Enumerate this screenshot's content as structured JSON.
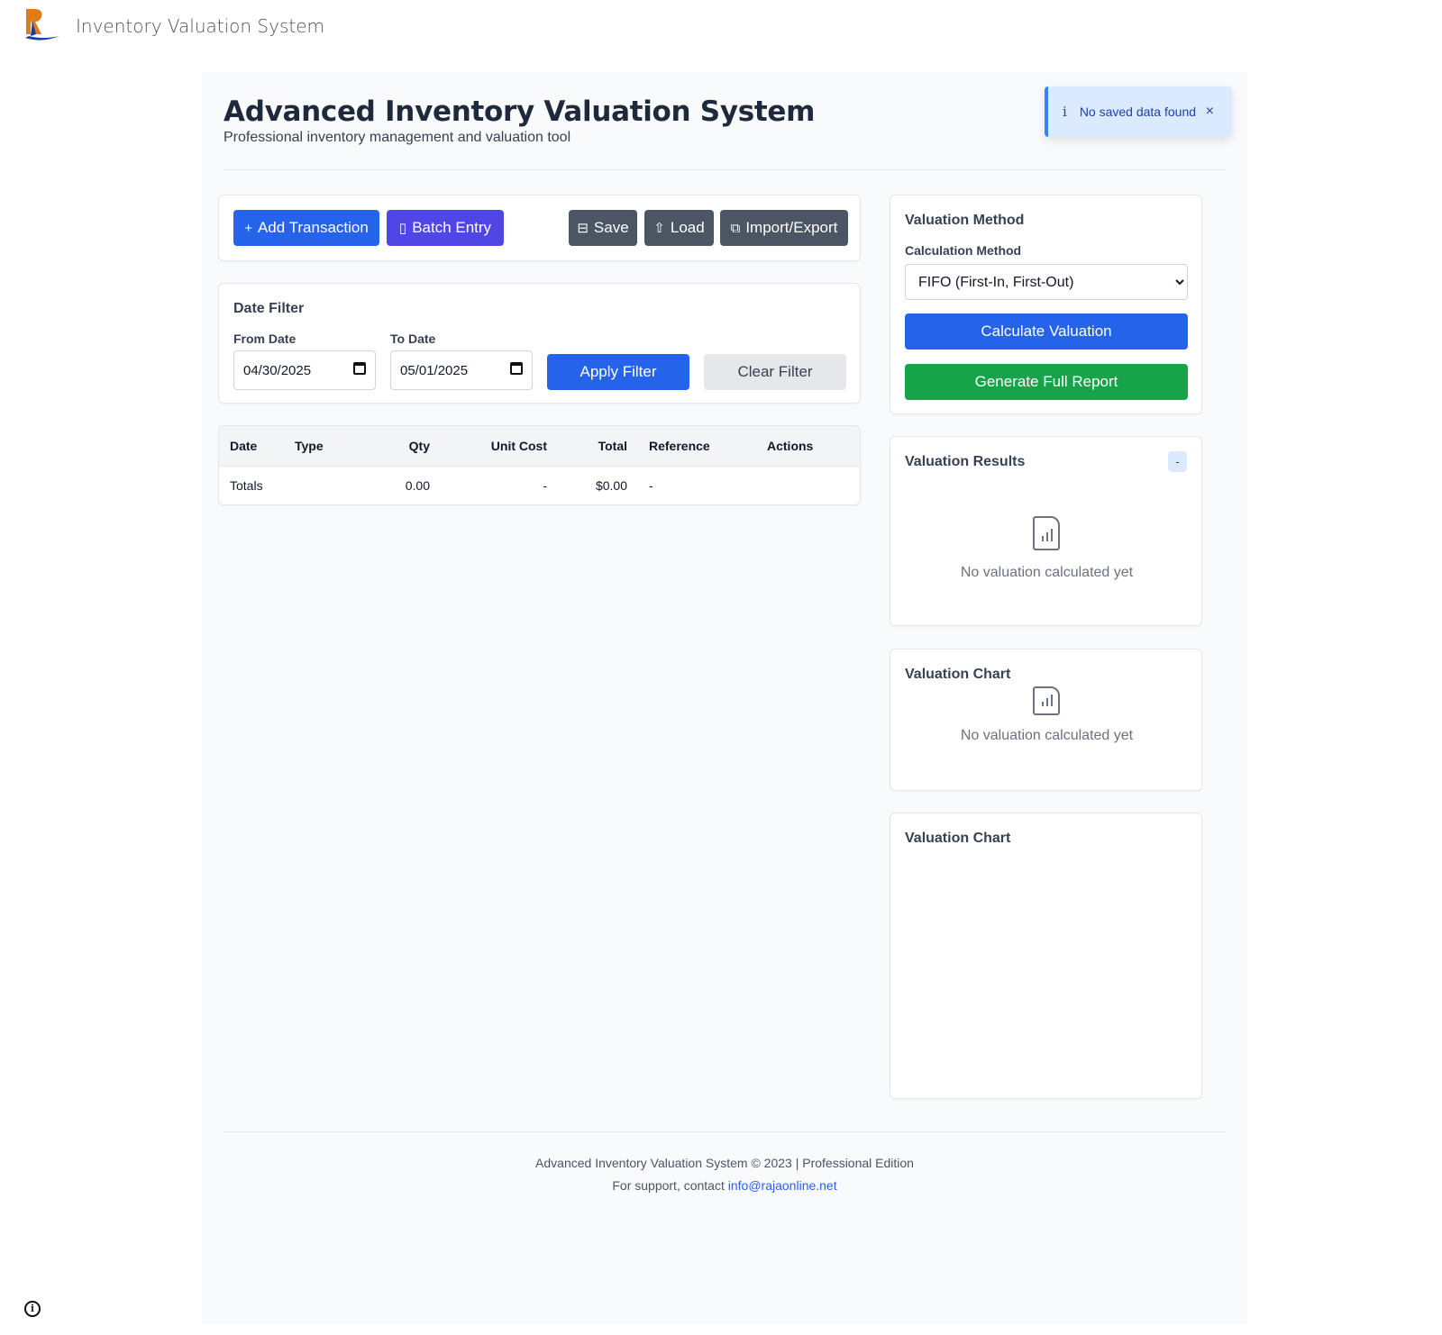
{
  "app": {
    "name": "Inventory Valuation System"
  },
  "header": {
    "title": "Advanced Inventory Valuation System",
    "subtitle": "Professional inventory management and valuation tool"
  },
  "toast": {
    "icon": "i",
    "message": "No saved data found",
    "close": "×"
  },
  "toolbar": {
    "add_transaction": "Add Transaction",
    "batch_entry": "Batch Entry",
    "save": "Save",
    "load": "Load",
    "import_export": "Import/Export"
  },
  "date_filter": {
    "title": "Date Filter",
    "from_label": "From Date",
    "from_value": "04/30/2025",
    "to_label": "To Date",
    "to_value": "05/01/2025",
    "apply": "Apply Filter",
    "clear": "Clear Filter"
  },
  "table": {
    "headers": [
      "Date",
      "Type",
      "Qty",
      "Unit Cost",
      "Total",
      "Reference",
      "Actions"
    ],
    "totals": {
      "label": "Totals",
      "qty": "0.00",
      "unit_cost": "-",
      "total": "$0.00",
      "reference": "-"
    }
  },
  "valuation_method": {
    "title": "Valuation Method",
    "calc_label": "Calculation Method",
    "selected": "FIFO (First-In, First-Out)",
    "calculate": "Calculate Valuation",
    "report": "Generate Full Report"
  },
  "results": {
    "title": "Valuation Results",
    "badge": "-",
    "empty": "No valuation calculated yet"
  },
  "chart1": {
    "title": "Valuation Chart",
    "empty": "No valuation calculated yet"
  },
  "chart2": {
    "title": "Valuation Chart"
  },
  "footer": {
    "line1": "Advanced Inventory Valuation System © 2023 | Professional Edition",
    "line2_prefix": "For support, contact ",
    "email": "info@rajaonline.net"
  },
  "colors": {
    "primary": "#2563eb",
    "purple": "#4f46e5",
    "green": "#16a34a",
    "dark": "#4b5563"
  }
}
